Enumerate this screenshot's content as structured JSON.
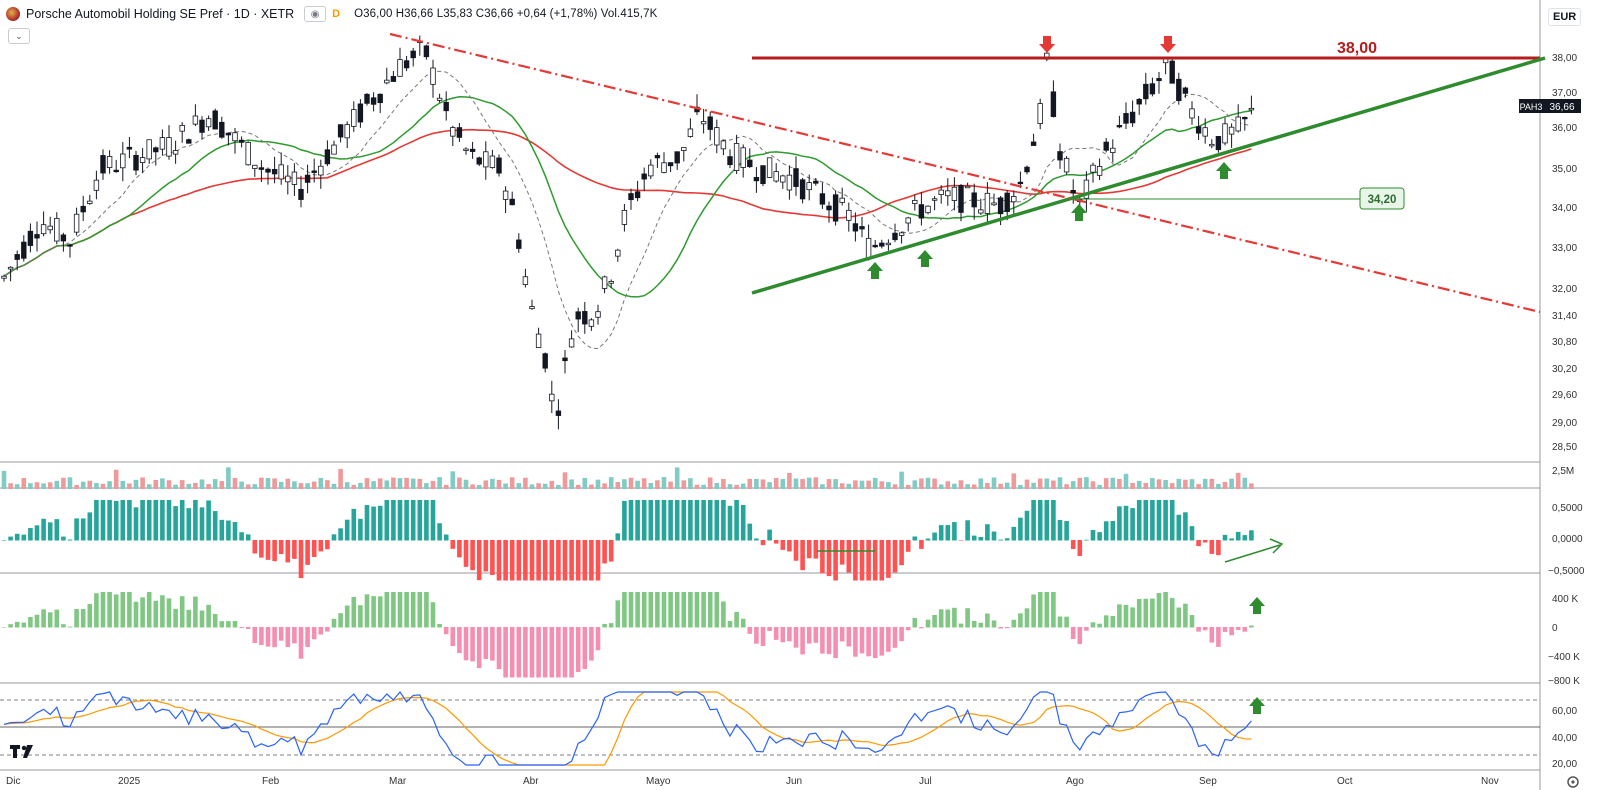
{
  "header": {
    "symbol": "Porsche Automobil Holding SE Pref · 1D · XETR",
    "interval_badge": "D",
    "ohlc": "O36,00 H36,66 L35,83 C36,66 +0,64 (+1,78%) Vol.415,7K"
  },
  "currency": "EUR",
  "chart_data": {
    "type": "candlestick",
    "price_axis_ticks": [
      "38,00",
      "37,00",
      "36,00",
      "35,00",
      "34,00",
      "33,00",
      "32,00",
      "31,40",
      "30,80",
      "30,20",
      "29,60",
      "29,00",
      "28,50"
    ],
    "time_axis_ticks": [
      "Dic",
      "2025",
      "Feb",
      "Mar",
      "Abr",
      "Mayo",
      "Jun",
      "Jul",
      "Ago",
      "Sep",
      "Oct",
      "Nov"
    ],
    "last_price_symbol": "PAH3",
    "last_price_label": "36,66",
    "resistance_label": "38,00",
    "support_label": "34,20",
    "volume_axis_label": "2,5M",
    "macd_ticks": [
      "0,5000",
      "0,0000",
      "−0,5000"
    ],
    "obv_ticks": [
      "400 K",
      "0",
      "−400 K",
      "−800 K"
    ],
    "rsi_ticks": [
      "60,00",
      "40,00",
      "20,00"
    ],
    "price_levels": [
      38.0,
      37.0,
      36.0,
      35.0,
      34.0,
      33.0,
      32.0,
      31.4,
      30.8,
      30.2,
      29.6,
      29.0,
      28.5
    ],
    "price_anchors": {
      "start": 32.3,
      "jan_low": 33.4,
      "mar_high": 38.2,
      "mar_end": 35.5,
      "apr_low": 28.9,
      "may_high": 36.6,
      "jun_low": 33.2,
      "jul": 34.5,
      "aug_high": 37.9,
      "aug_low": 34.2,
      "late_aug_high": 37.8,
      "last": 36.66
    },
    "colors": {
      "up": "#26a69a",
      "down": "#ef5350",
      "resistance": "#b71c1c",
      "support": "#2e8b2e",
      "trend": "#e53935",
      "ma_fast": "#2e9b2e",
      "ma_slow": "#e53935"
    }
  }
}
